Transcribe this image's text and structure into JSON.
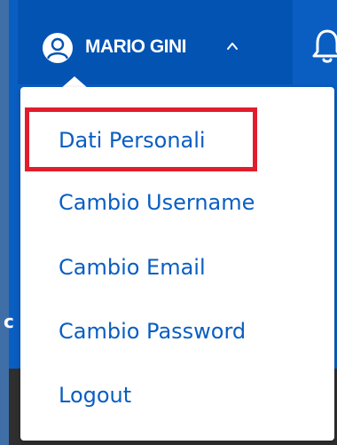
{
  "header": {
    "user_name": "MARIO GINI",
    "avatar_icon": "user-circle-icon",
    "chevron_icon": "chevron-up-icon",
    "notification_icon": "bell-icon",
    "partial_text": "c"
  },
  "dropdown": {
    "items": [
      {
        "label": "Dati Personali"
      },
      {
        "label": "Cambio Username"
      },
      {
        "label": "Cambio Email"
      },
      {
        "label": "Cambio Password"
      },
      {
        "label": "Logout"
      }
    ],
    "highlighted_item": "Dati Personali"
  },
  "colors": {
    "header_blue": "#0a5ec2",
    "user_button_blue": "#0353b3",
    "menu_text": "#0a5ec2",
    "highlight_red": "#e11d2d"
  }
}
